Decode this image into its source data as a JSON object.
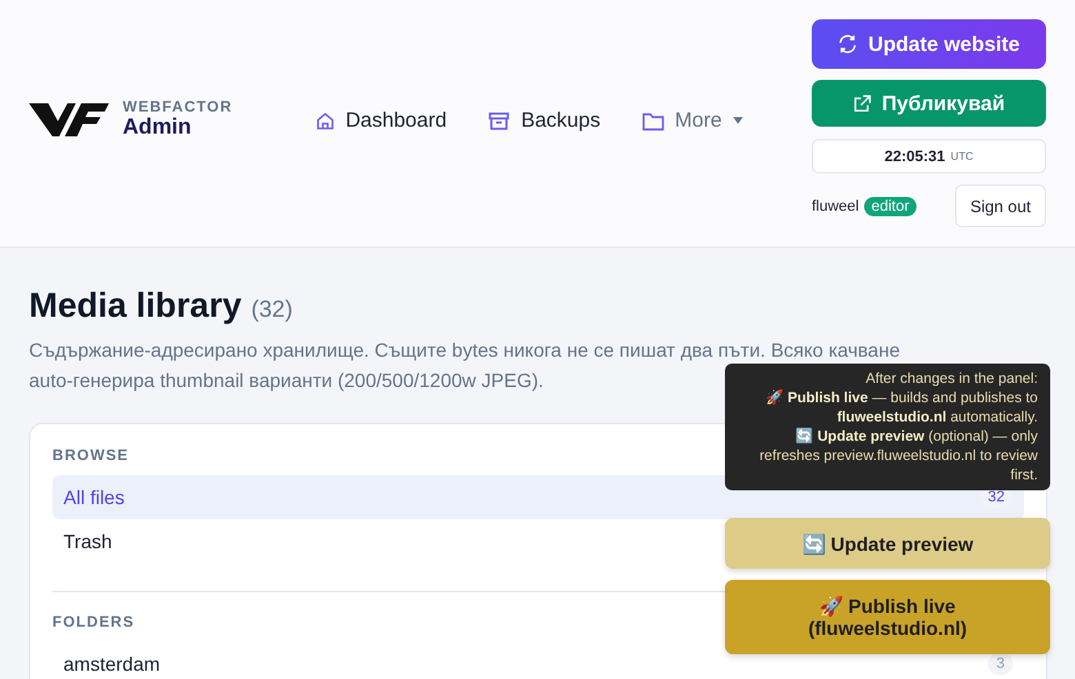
{
  "header": {
    "brand_top": "WEBFACTOR",
    "brand_bottom": "Admin",
    "nav": [
      {
        "label": "Dashboard",
        "dropdown": false
      },
      {
        "label": "Backups",
        "dropdown": false
      },
      {
        "label": "More",
        "dropdown": true
      }
    ],
    "update_button": "Update website",
    "publish_button": "Публикувай",
    "clock": {
      "time": "22:05:31",
      "zone": "UTC"
    },
    "user": {
      "name": "fluweel",
      "role": "editor"
    },
    "sign_out": "Sign out"
  },
  "page": {
    "title": "Media library",
    "count": "(32)",
    "description_lines": [
      "Съдържание-адресирано хранилище. Същите bytes никога не се пишат два пъти. Всяко качване",
      "auto-генерира thumbnail варианти (200/500/1200w JPEG)."
    ]
  },
  "sections": [
    {
      "heading": "BROWSE",
      "items": [
        {
          "label": "All files",
          "count": "32",
          "selected": true
        },
        {
          "label": "Trash",
          "selected": false
        }
      ]
    },
    {
      "heading": "FOLDERS",
      "items": [
        {
          "label": "amsterdam",
          "count": "3",
          "selected": false
        }
      ]
    }
  ],
  "floating": {
    "tooltip": [
      "After changes in the panel:",
      "🚀 **Publish live** — builds and publishes to **fluweelstudio.nl** automatically.",
      "🔄 **Update preview** (optional) — only refreshes preview.fluweelstudio.nl to review first."
    ],
    "preview_button": "🔄 Update preview",
    "publish_lines": [
      "🚀 Publish live",
      "(fluweelstudio.nl)"
    ]
  }
}
